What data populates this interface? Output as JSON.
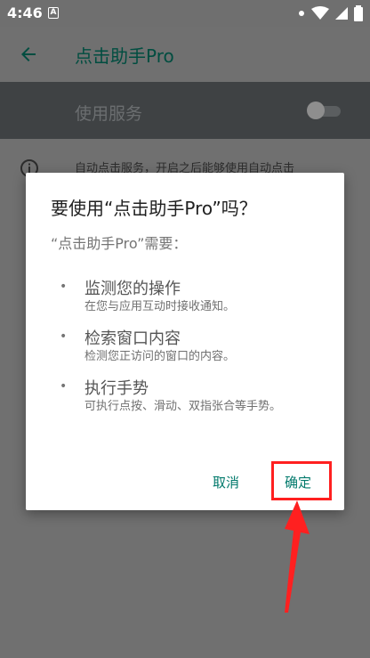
{
  "status_bar": {
    "time": "4:46",
    "notification_badge": "A"
  },
  "app_bar": {
    "title": "点击助手Pro",
    "back_icon": "arrow-left-icon"
  },
  "service": {
    "label": "使用服务",
    "enabled": false
  },
  "background_info": {
    "text": "自动点击服务，开启之后能够使用自动点击"
  },
  "dialog": {
    "title": "要使用“点击助手Pro”吗？",
    "subtitle": "“点击助手Pro”需要：",
    "permissions": [
      {
        "title": "监测您的操作",
        "description": "在您与应用互动时接收通知。"
      },
      {
        "title": "检索窗口内容",
        "description": "检测您正访问的窗口的内容。"
      },
      {
        "title": "执行手势",
        "description": "可执行点按、滑动、双指张合等手势。"
      }
    ],
    "cancel_label": "取消",
    "ok_label": "确定"
  },
  "colors": {
    "accent": "#00796b",
    "title_color": "#004d40",
    "highlight": "#ff2020",
    "overlay": "#707070"
  }
}
